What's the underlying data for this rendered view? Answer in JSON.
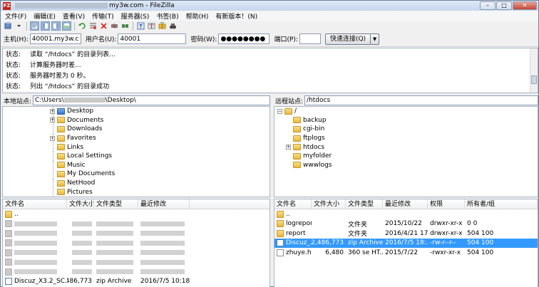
{
  "window": {
    "title_suffix": "my3w.com - FileZilla",
    "app_icon_label": "FZ",
    "btn_min": "–",
    "btn_max": "□",
    "btn_close": "✕"
  },
  "menu": [
    "文件(F)",
    "编辑(E)",
    "查看(V)",
    "传输(T)",
    "服务器(S)",
    "书签(B)",
    "帮助(H)",
    "有新版本！(N)"
  ],
  "quickconnect": {
    "host_label": "主机(H):",
    "host_value": "40001.my3w.com",
    "user_label": "用户名(U):",
    "user_value": "40001",
    "pass_label": "密码(W):",
    "pass_value": "●●●●●●●●",
    "port_label": "端口(P):",
    "port_value": "",
    "connect_label": "快速连接(Q)",
    "dropdown_arrow": "▼"
  },
  "log": [
    {
      "status": "状态:",
      "msg": "读取 “/htdocs” 的目录列表..."
    },
    {
      "status": "状态:",
      "msg": "计算服务器时差..."
    },
    {
      "status": "状态:",
      "msg": "服务器时差为 0 秒。"
    },
    {
      "status": "状态:",
      "msg": "列出 “/htdocs” 的目录成功"
    }
  ],
  "local": {
    "path_label": "本地站点:",
    "path_prefix": "C:\\Users\\",
    "path_suffix": "\\Desktop\\",
    "tree": [
      {
        "name": "Desktop",
        "expand": "+",
        "icon": "blue"
      },
      {
        "name": "Documents",
        "expand": "+",
        "icon": "yellow"
      },
      {
        "name": "Downloads",
        "expand": "",
        "icon": "yellow"
      },
      {
        "name": "Favorites",
        "expand": "+",
        "icon": "star"
      },
      {
        "name": "Links",
        "expand": "",
        "icon": "yellow"
      },
      {
        "name": "Local Settings",
        "expand": "",
        "icon": "yellow"
      },
      {
        "name": "Music",
        "expand": "",
        "icon": "yellow"
      },
      {
        "name": "My Documents",
        "expand": "",
        "icon": "yellow"
      },
      {
        "name": "NetHood",
        "expand": "",
        "icon": "yellow"
      },
      {
        "name": "Pictures",
        "expand": "",
        "icon": "yellow"
      }
    ],
    "columns": [
      "文件名",
      "文件大小",
      "文件类型",
      "最近修改"
    ],
    "rows": [
      {
        "name": "..",
        "size": "",
        "type": "",
        "modified": "",
        "icon": "folder",
        "blurred": false
      },
      {
        "name": "",
        "size": "",
        "type": "",
        "modified": "",
        "icon": "blurred",
        "blurred": true
      },
      {
        "name": "",
        "size": "",
        "type": "",
        "modified": "",
        "icon": "blurred",
        "blurred": true
      },
      {
        "name": "",
        "size": "",
        "type": "",
        "modified": "",
        "icon": "blurred",
        "blurred": true
      },
      {
        "name": "",
        "size": "",
        "type": "",
        "modified": "",
        "icon": "blurred",
        "blurred": true
      },
      {
        "name": "",
        "size": "",
        "type": "",
        "modified": "",
        "icon": "blurred",
        "blurred": true
      },
      {
        "name": "",
        "size": "",
        "type": "",
        "modified": "",
        "icon": "blurred",
        "blurred": true
      },
      {
        "name": "Discuz_X3.2_SC...",
        "size": "12,486,773",
        "type": "zip Archive",
        "modified": "2016/7/5 10:18:35",
        "icon": "zip",
        "blurred": false
      }
    ]
  },
  "remote": {
    "path_label": "远程站点:",
    "path_value": "/htdocs",
    "tree": [
      {
        "name": "/",
        "expand": "−",
        "level": 0
      },
      {
        "name": "backup",
        "expand": "",
        "level": 1
      },
      {
        "name": "cgi-bin",
        "expand": "",
        "level": 1
      },
      {
        "name": "ftplogs",
        "expand": "",
        "level": 1
      },
      {
        "name": "htdocs",
        "expand": "+",
        "level": 1
      },
      {
        "name": "myfolder",
        "expand": "",
        "level": 1
      },
      {
        "name": "wwwlogs",
        "expand": "",
        "level": 1
      }
    ],
    "columns": [
      "文件名",
      "文件大小",
      "文件类型",
      "最近修改",
      "权限",
      "所有者/组"
    ],
    "rows": [
      {
        "name": "..",
        "size": "",
        "type": "",
        "modified": "",
        "perms": "",
        "owner": "",
        "icon": "folder",
        "selected": false
      },
      {
        "name": "logreport",
        "size": "",
        "type": "文件夹",
        "modified": "2015/10/22",
        "perms": "drwxr-xr-x",
        "owner": "0 0",
        "icon": "folder",
        "selected": false
      },
      {
        "name": "report",
        "size": "",
        "type": "文件夹",
        "modified": "2016/4/21 17...",
        "perms": "drwxr-xr-x",
        "owner": "504 100",
        "icon": "folder",
        "selected": false
      },
      {
        "name": "Discuz_...",
        "size": "12,486,773",
        "type": "zip Archive",
        "modified": "2016/7/5 18:...",
        "perms": "-rw-r--r--",
        "owner": "504 100",
        "icon": "zip",
        "selected": true
      },
      {
        "name": "zhuye.ht...",
        "size": "6,480",
        "type": "360 se HT...",
        "modified": "2015/7/22",
        "perms": "-rwxr-xr-x",
        "owner": "504 100",
        "icon": "doc",
        "selected": false
      }
    ]
  },
  "colors": {
    "selection": "#3399ff",
    "folder": "#e8b83c",
    "desktop_folder": "#3a73c8"
  }
}
